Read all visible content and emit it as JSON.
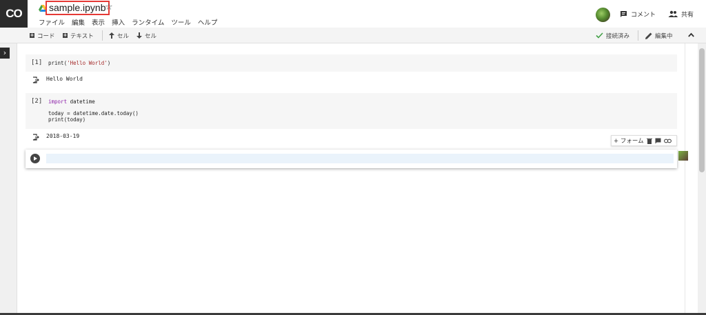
{
  "app": {
    "logo_text": "CO",
    "notebook_title": "sample.ipynb",
    "star_glyph": "☆"
  },
  "menu": [
    "ファイル",
    "編集",
    "表示",
    "挿入",
    "ランタイム",
    "ツール",
    "ヘルプ"
  ],
  "header_right": {
    "comment_label": "コメント",
    "share_label": "共有"
  },
  "toolbar": {
    "add_code_label": "コード",
    "add_text_label": "テキスト",
    "cell_up_label": "セル",
    "cell_down_label": "セル",
    "connected_label": "接続済み",
    "editing_label": "編集中"
  },
  "cells": [
    {
      "prompt": "[1]",
      "code_parts": {
        "fn": "print(",
        "str": "'Hello World'",
        "close": ")"
      },
      "output": "Hello World"
    },
    {
      "prompt": "[2]",
      "code_line1_kw": "import",
      "code_line1_rest": " datetime",
      "code_line2": "today = datetime.date.today()",
      "code_line3": "print(today)",
      "output": "2018-03-19"
    }
  ],
  "cell_tools": {
    "form_label": "+ フォーム"
  },
  "colors": {
    "title_highlight": "#e53935",
    "keyword": "#8e24aa",
    "string": "#a52a2a",
    "connected_check": "#43a047"
  }
}
